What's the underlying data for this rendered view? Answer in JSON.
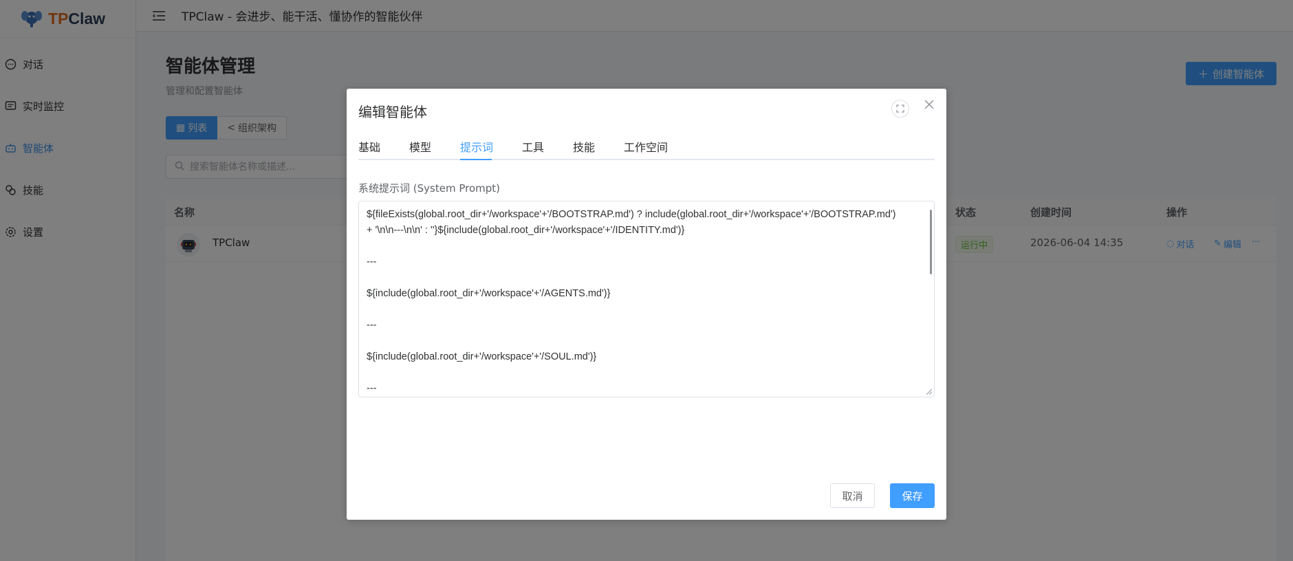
{
  "app": {
    "logo_tp": "TP",
    "logo_claw": "Claw",
    "top_title": "TPClaw - 会进步、能干活、懂协作的智能伙伴"
  },
  "sidebar": {
    "items": [
      {
        "label": "对话",
        "icon": "chat-bubble-icon",
        "active": false
      },
      {
        "label": "实时监控",
        "icon": "monitor-message-icon",
        "active": false
      },
      {
        "label": "智能体",
        "icon": "robot-icon",
        "active": true
      },
      {
        "label": "技能",
        "icon": "skill-icon",
        "active": false
      },
      {
        "label": "设置",
        "icon": "gear-icon",
        "active": false
      }
    ]
  },
  "page": {
    "title": "智能体管理",
    "subtitle": "管理和配置智能体",
    "create_label": "创建智能体",
    "view_list": "列表",
    "view_org": "组织架构",
    "search_placeholder": "搜索智能体名称或描述..."
  },
  "table": {
    "headers": {
      "name": "名称",
      "status": "状态",
      "created": "创建时间",
      "actions": "操作"
    },
    "rows": [
      {
        "name": "TPClaw",
        "status": "运行中",
        "created": "2026-06-04 14:35",
        "action_chat": "对话",
        "action_edit": "编辑",
        "action_more": "···"
      }
    ]
  },
  "dialog": {
    "title": "编辑智能体",
    "tabs": [
      "基础",
      "模型",
      "提示词",
      "工具",
      "技能",
      "工作空间"
    ],
    "active_tab": "提示词",
    "field_label": "系统提示词 (System Prompt)",
    "prompt": "${fileExists(global.root_dir+'/workspace'+'/BOOTSTRAP.md') ? include(global.root_dir+'/workspace'+'/BOOTSTRAP.md')\n+ '\\n\\n---\\n\\n' : ''}${include(global.root_dir+'/workspace'+'/IDENTITY.md')}\n\n---\n\n${include(global.root_dir+'/workspace'+'/AGENTS.md')}\n\n---\n\n${include(global.root_dir+'/workspace'+'/SOUL.md')}\n\n---",
    "cancel_label": "取消",
    "save_label": "保存"
  },
  "colors": {
    "primary": "#409eff",
    "success": "#67c23a",
    "logo_orange": "#e06c1a",
    "logo_navy": "#2b3e57"
  }
}
